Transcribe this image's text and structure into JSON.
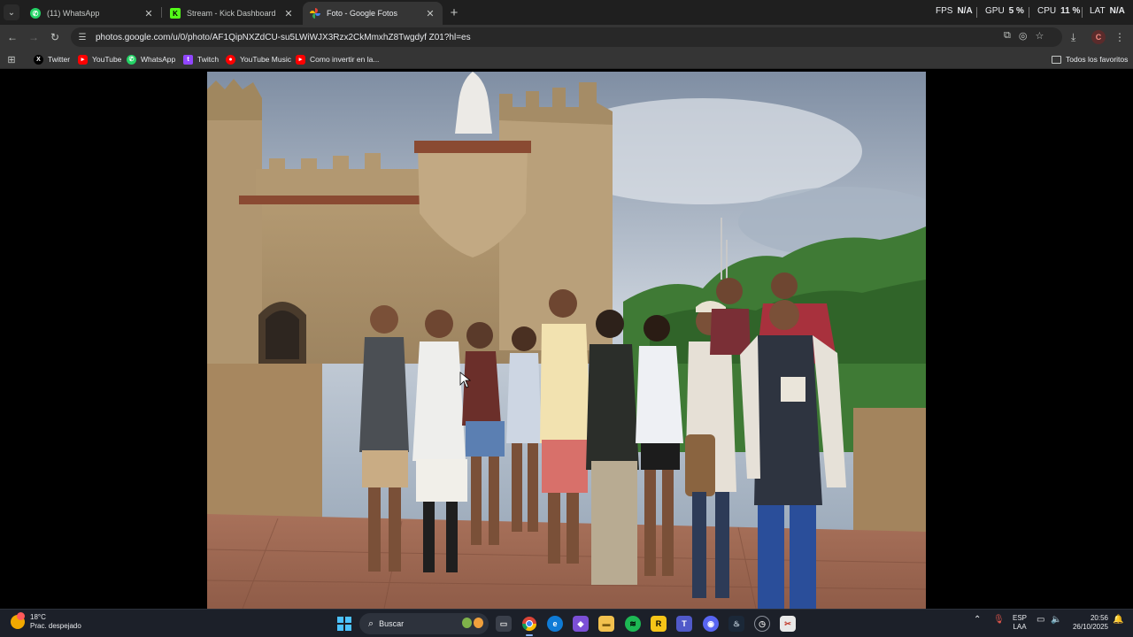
{
  "browser": {
    "tabs": [
      {
        "title": "(11) WhatsApp",
        "icon": "whatsapp-icon",
        "color": "#25d366",
        "active": false
      },
      {
        "title": "Stream - Kick Dashboard",
        "icon": "kick-icon",
        "color": "#53fc18",
        "active": false
      },
      {
        "title": "Foto - Google Fotos",
        "icon": "google-photos-icon",
        "color": "#fbbc04",
        "active": true
      }
    ],
    "overlay": {
      "fps_label": "FPS",
      "fps_value": "N/A",
      "gpu_label": "GPU",
      "gpu_value": "5 %",
      "cpu_label": "CPU",
      "cpu_value": "11 %",
      "lat_label": "LAT",
      "lat_value": "N/A"
    },
    "url": "photos.google.com/u/0/photo/AF1QipNXZdCU-su5LWiWJX3Rzx2CkMmxhZ8Twgdyf Z01?hl=es",
    "profile_initial": "C",
    "bookmarks": [
      {
        "label": "Twitter",
        "icon": "x-twitter-icon",
        "color": "#000000"
      },
      {
        "label": "YouTube",
        "icon": "youtube-icon",
        "color": "#ff0000"
      },
      {
        "label": "WhatsApp",
        "icon": "whatsapp-icon",
        "color": "#25d366"
      },
      {
        "label": "Twitch",
        "icon": "twitch-icon",
        "color": "#9146ff"
      },
      {
        "label": "YouTube Music",
        "icon": "youtube-music-icon",
        "color": "#ff0000"
      },
      {
        "label": "Como invertir en la...",
        "icon": "youtube-icon",
        "color": "#ff0000"
      }
    ],
    "all_bookmarks": "Todos los favoritos"
  },
  "taskbar": {
    "weather_temp": "18°C",
    "weather_desc": "Prac. despejado",
    "search_label": "Buscar",
    "lang_line1": "ESP",
    "lang_line2": "LAA",
    "time": "20:56",
    "date": "26/10/2025"
  }
}
